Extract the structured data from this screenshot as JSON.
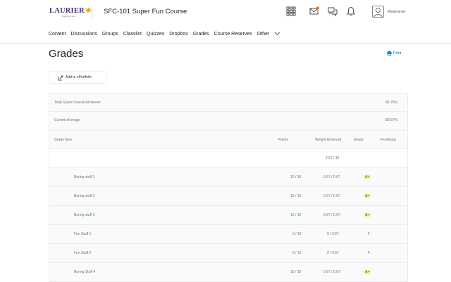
{
  "header": {
    "logo_text": "LAURIER",
    "logo_subtext": "Inspiring Lives",
    "course_title": "SFC-101 Super Fun Course",
    "username": "Wadenener",
    "icons": [
      "apps-grid-icon",
      "mail-icon",
      "chat-icon",
      "bell-icon",
      "user-avatar-icon"
    ],
    "mail_badge_color": "#e87511"
  },
  "nav": {
    "items": [
      "Content",
      "Discussions",
      "Groups",
      "Classlist",
      "Quizzes",
      "Dropbox",
      "Grades",
      "Course Reserves",
      "Other"
    ]
  },
  "page": {
    "title": "Grades",
    "print_label": "Print",
    "eportfolio_label": "Add to ePortfolio"
  },
  "summary": {
    "overall_label": "Total Grade Overall Achieved:",
    "overall_value": "43.75%",
    "average_label": "Current Average:",
    "average_value": "89.67%"
  },
  "columns": {
    "item": "Grade Item",
    "points": "Points",
    "weight": "Weight Achieved",
    "grade": "Grade",
    "feedback": "Feedback"
  },
  "category_row": {
    "weight": "2.57 / 10"
  },
  "rows": [
    {
      "name": "Boring stuff 1",
      "points": "10 / 10",
      "weight": "0.67 / 0.67",
      "grade": "A+"
    },
    {
      "name": "Boring stuff 2",
      "points": "10 / 10",
      "weight": "0.67 / 0.67",
      "grade": "A+"
    },
    {
      "name": "Boring stuff 3",
      "points": "10 / 10",
      "weight": "0.67 / 0.67",
      "grade": "A+"
    },
    {
      "name": "Fun Stuff 1",
      "points": "0 / 10",
      "weight": "0 / 0.67",
      "grade": "F"
    },
    {
      "name": "Fun Stuff 2",
      "points": "0 / 10",
      "weight": "0 / 0.67",
      "grade": "F"
    },
    {
      "name": "Boring Stuff 4",
      "points": "10 / 10",
      "weight": "0.67 / 0.67",
      "grade": "A+"
    }
  ],
  "colors": {
    "accent_link": "#006fbf",
    "logo_purple": "#4a2d7a",
    "logo_gold": "#f2a900",
    "grade_highlight": "#f3f99a"
  }
}
